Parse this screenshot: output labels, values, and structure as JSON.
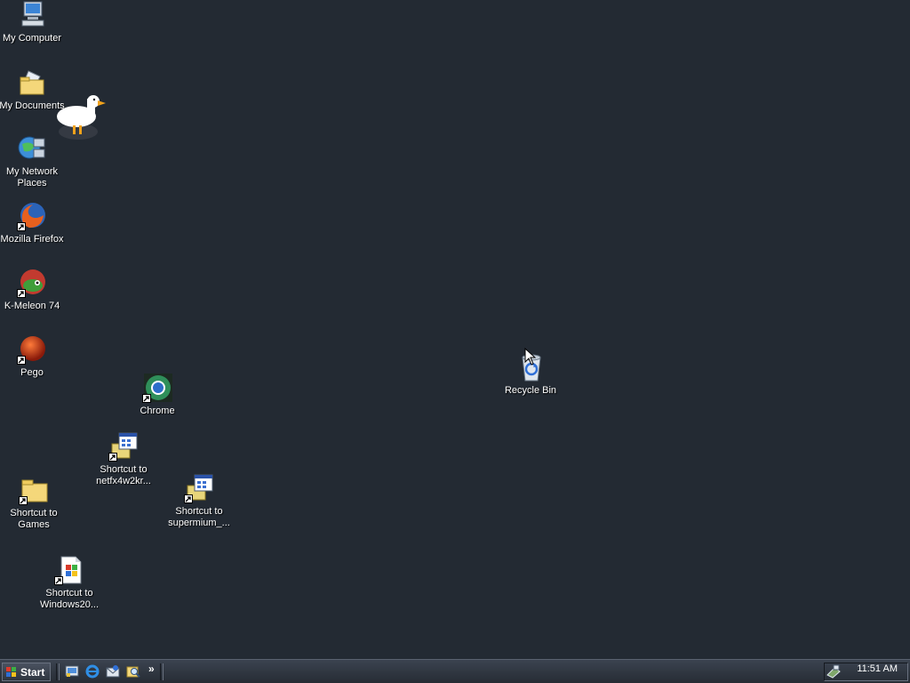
{
  "desktop": {
    "icons": [
      {
        "id": "my-computer",
        "label": "My Computer",
        "icon": "computer-icon"
      },
      {
        "id": "my-documents",
        "label": "My Documents",
        "icon": "documents-folder-icon"
      },
      {
        "id": "my-network-places",
        "label": "My Network\nPlaces",
        "icon": "network-places-icon"
      },
      {
        "id": "mozilla-firefox",
        "label": "Mozilla Firefox",
        "icon": "firefox-icon"
      },
      {
        "id": "k-meleon",
        "label": "K-Meleon 74",
        "icon": "k-meleon-icon"
      },
      {
        "id": "pego",
        "label": "Pego",
        "icon": "pego-icon"
      },
      {
        "id": "chrome",
        "label": "Chrome",
        "icon": "chrome-icon"
      },
      {
        "id": "netfx",
        "label": "Shortcut to\nnetfx4w2kr...",
        "icon": "installer-icon"
      },
      {
        "id": "games",
        "label": "Shortcut to\nGames",
        "icon": "folder-icon"
      },
      {
        "id": "supermium",
        "label": "Shortcut to\nsupermium_...",
        "icon": "installer-icon"
      },
      {
        "id": "windows20",
        "label": "Shortcut to\nWindows20...",
        "icon": "windows-document-icon"
      },
      {
        "id": "recycle-bin",
        "label": "Recycle Bin",
        "icon": "recycle-bin-icon"
      }
    ],
    "mascot": "goose-icon"
  },
  "taskbar": {
    "start_label": "Start",
    "quick_launch": [
      "show-desktop-icon",
      "internet-explorer-icon",
      "outlook-express-icon",
      "search-icon"
    ],
    "overflow_label": "»",
    "clock": "11:51 AM"
  },
  "colors": {
    "desktop_bg": "#232a33",
    "taskbar_bg": "#2e353f"
  }
}
